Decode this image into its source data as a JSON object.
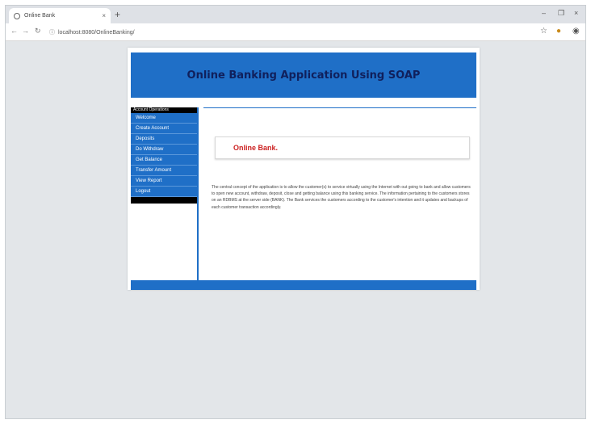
{
  "browser": {
    "tab_title": "Online Bank",
    "tab_close": "×",
    "new_tab": "+",
    "address": "localhost:8080/OnlineBanking/",
    "win_minimize": "–",
    "win_maximize": "❐",
    "win_close": "×",
    "back": "←",
    "forward": "→",
    "reload": "↻"
  },
  "header": {
    "title": "Online Banking Application Using SOAP"
  },
  "sidebar": {
    "heading": "Account Operations",
    "items": [
      {
        "label": "Welcome"
      },
      {
        "label": "Create Account"
      },
      {
        "label": "Deposits"
      },
      {
        "label": "Do Withdraw"
      },
      {
        "label": "Get Balance"
      },
      {
        "label": "Transfer Amount"
      },
      {
        "label": "View Report"
      },
      {
        "label": "Logout"
      }
    ]
  },
  "main": {
    "welcome_text": "Online Bank.",
    "description": "The central concept of the application is to allow the customer(s) to service virtually using the Internet with out going to bank and allow customers to open new account, withdraw, deposit, close and getting balance using this banking service. The information pertaining to the customers stores on an RDBMS at the server side (BANK). The Bank services the customers according to the customer's intention and it updates and backups of each customer transaction accordingly."
  },
  "colors": {
    "primary": "#1f6fc7",
    "title_text": "#10205c",
    "accent": "#cc2222"
  }
}
